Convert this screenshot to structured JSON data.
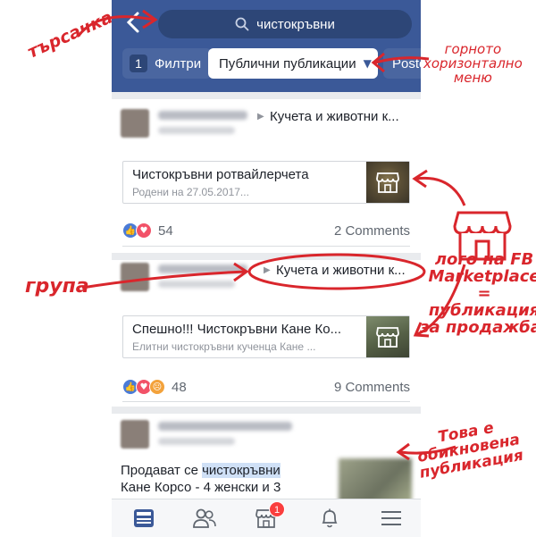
{
  "search": {
    "query": "чистокръвни"
  },
  "filters": {
    "count": "1",
    "filters_label": "Филтри",
    "public_posts_label": "Публични публикации",
    "posts_label": "Poste"
  },
  "posts": [
    {
      "group": "Кучета и животни к...",
      "listing_title": "Чистокръвни ротвайлерчета",
      "listing_subtitle": "Родени на 27.05.2017...",
      "reaction_count": "54",
      "comments": "2 Comments"
    },
    {
      "group": "Кучета и животни к...",
      "listing_title": "Спешно!!! Чистокръвни Кане Ко...",
      "listing_subtitle": "Елитни чистокръвни кученца Кане ...",
      "reaction_count": "48",
      "comments": "9 Comments"
    },
    {
      "text_before": "Продават се ",
      "text_highlight": "чистокръвни",
      "text_after": "Кане Корсо - 4 женски и 3"
    }
  ],
  "bottom_nav": {
    "items": [
      "news-feed-icon",
      "friends-icon",
      "marketplace-icon",
      "notifications-icon",
      "menu-icon"
    ],
    "marketplace_badge": "1"
  },
  "annotations": {
    "search": "търсачка",
    "menu": [
      "горното",
      "хоризонтално",
      "меню"
    ],
    "group": "група",
    "marketplace": [
      "лого на FB",
      "Marketplace",
      "=",
      "публикация",
      "за продажба!"
    ],
    "normal_post": [
      "Това е",
      "обикновена",
      "публикация"
    ]
  },
  "colors": {
    "facebook_blue": "#3b5998",
    "annotation_red": "#d9262c",
    "highlight": "#cfe0f6"
  }
}
